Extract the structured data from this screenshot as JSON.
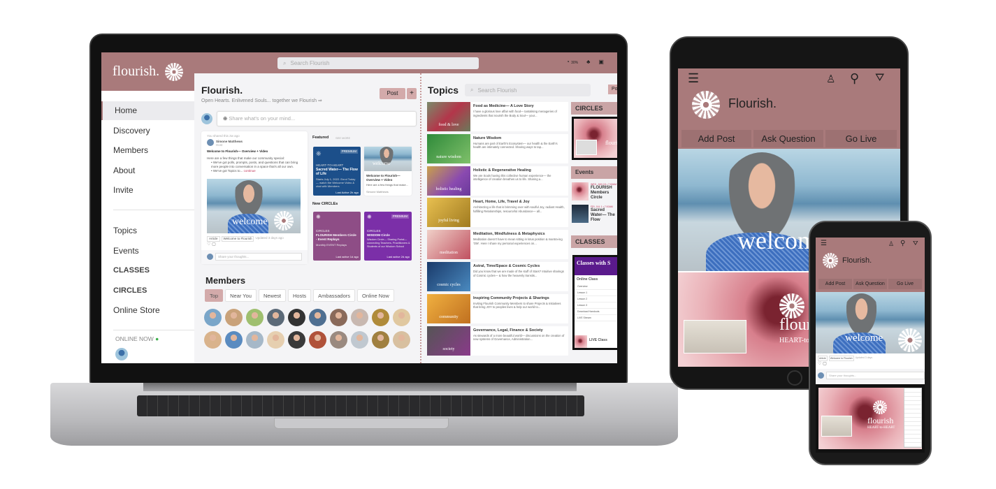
{
  "colors": {
    "brand": "#a97a7b",
    "sidebar_active": "#ebebee",
    "circle_card_1": "#8e4d86",
    "circle_card_2": "#7b2fa8",
    "featured_card": "#1c4f8a",
    "online_dot": "#3cae4b"
  },
  "laptop": {
    "logo": "flourish.",
    "search_placeholder": "Search Flourish",
    "top_icons": {
      "progress": "30%",
      "progress_icon": "pie-chart-icon",
      "members_icon": "people-icon",
      "chat_icon": "chat-icon"
    },
    "sidebar": {
      "items": [
        {
          "label": "Home",
          "active": true
        },
        {
          "label": "Discovery"
        },
        {
          "label": "Members"
        },
        {
          "label": "About"
        },
        {
          "label": "Invite"
        }
      ],
      "items2": [
        {
          "label": "Topics"
        },
        {
          "label": "Events"
        },
        {
          "label": "CLASSES"
        },
        {
          "label": "CIRCLES"
        },
        {
          "label": "Online Store"
        }
      ],
      "online_now": "ONLINE NOW"
    },
    "main": {
      "title": "Flourish.",
      "subtitle": "Open Hearts. Enlivened Souls... together we Flourish ⇒",
      "post_button": "Post",
      "add_button": "+",
      "share_placeholder": "Share what's on your mind...",
      "post": {
        "meta": "You shared this 2w ago",
        "author": "Simone Matthews",
        "role": "Host",
        "title": "Welcome to Flourish— Overview + Video",
        "intro": "Here are a few things that make our community special:",
        "bullet1": "We've got polls, prompts, posts, and questions that can bring more people into conversation in a space that's all our own.",
        "bullet2": "We've got Topics to...",
        "continue": "continue",
        "image_text": "welcome",
        "tags": [
          "Article",
          "Welcome to Flourish",
          "Updated 3 days ago"
        ],
        "comment_placeholder": "Share your thoughts..."
      },
      "featured": {
        "label": "Featured",
        "see_more": "SEE MORE",
        "card1": {
          "badge": "PREMIUM",
          "kicker": "HEART-TO-HEART",
          "title": "Sacred Water— The Flow of Life",
          "desc": "Starts July 1, 2022. Enrol Today— watch the Welcome Video & chat with Members",
          "activity": "Last Active 2h ago"
        },
        "card2": {
          "image_text": "welcome",
          "title": "Welcome to Flourish— Overview + Video",
          "desc": "Here are a few things that make...",
          "author": "Simone Matthews"
        }
      },
      "new_circles": {
        "label": "New CIRCLEs",
        "card1": {
          "kicker": "CIRCLES",
          "title": "FLOURISH Members Circle - Event Replays",
          "desc": "Monthly EVENT Replays",
          "activity": "Last active 1d ago"
        },
        "card2": {
          "badge": "PREMIUM",
          "kicker": "CIRCLES",
          "title": "WISDOM Circle",
          "desc": "Wisdom Circle— Sharing Portal— connecting Teachers, Practitioners & Students of our Wisdom School",
          "activity": "Last active 2d ago"
        }
      },
      "members": {
        "title": "Members",
        "tabs": [
          "Top",
          "Near You",
          "Newest",
          "Hosts",
          "Ambassadors",
          "Online Now"
        ],
        "active_tab": "Top",
        "avatar_count": 20
      }
    },
    "topics": {
      "title": "Topics",
      "search_placeholder": "Search Flourish",
      "items": [
        {
          "thumb": "food & love",
          "title": "Food as Medicine— A Love Story",
          "desc": "I have a glorious love affair with food— tantalising menageries of ingredients that nourish the Body & Soul— your..."
        },
        {
          "thumb": "nature wisdom",
          "title": "Nature Wisdom",
          "desc": "Humans are part of Earth's Ecosystem— our health & the Earth's health are intimately connected. Sharing ways to tap..."
        },
        {
          "thumb": "holistic healing",
          "title": "Holistic & Regenerative Healing",
          "desc": "We are Souls having this collective human experience— the intelligence of creation breathes us to life. Sharing a..."
        },
        {
          "thumb": "joyful living",
          "title": "Heart, Home, Life, Travel & Joy",
          "desc": "Architecting a life that is brimming over with soulful Joy, radiant Health, fulfilling Relationships, resourceful Abundance— all..."
        },
        {
          "thumb": "meditation",
          "title": "Meditation, Mindfulness & Metaphysics",
          "desc": "Meditation doesn't have to mean sitting in lotus position & mantra-ing 'OM'. Here I share my personal experiences on..."
        },
        {
          "thumb": "cosmic cycles",
          "title": "Astral, Time/Space & Cosmic Cycles",
          "desc": "Did you know that we are made of the stuff of Stars? Intuitive sharings of Cosmic cycles— & how the heavenly transits..."
        },
        {
          "thumb": "community",
          "title": "Inspiring Community Projects & Sharings",
          "desc": "Inviting Flourish Community Members to share Projects & Initiatives that bring JOY to peoples lives & help our world to..."
        },
        {
          "thumb": "society",
          "title": "Governance, Legal, Finance & Society",
          "desc": "As stewards of a more beautiful world— discussions on the creation of new systems of Governance, Administration..."
        }
      ],
      "post_button": "Post"
    },
    "right": {
      "circles": "CIRCLES",
      "circle_image_text": "flourish",
      "events": "Events",
      "event_items": [
        {
          "date": "WED, JUN 15 • 7:00AM",
          "title": "FLOURISH Members Circle"
        },
        {
          "date": "FRI, JUL 1 • 7:00AM",
          "title": "Sacred Water— The Flow"
        }
      ],
      "classes": "CLASSES",
      "classes_banner": "Classes with S",
      "classes_list_title": "Online Class",
      "lessons": [
        "Overview",
        "Lesson 1",
        "Lesson 2",
        "Lesson 3",
        "Download Handouts",
        "LIVE Stream"
      ],
      "live_class": "LIVE Class"
    }
  },
  "tablet": {
    "brand": "Flourish.",
    "actions": [
      "Add Post",
      "Ask Question",
      "Go Live"
    ],
    "hero_text": "welcom",
    "promo_title": "flouris",
    "promo_sub": "HEART-to-HEAR",
    "icons": [
      "menu-icon",
      "add-user-icon",
      "search-icon",
      "filter-icon"
    ]
  },
  "phone": {
    "brand": "Flourish.",
    "actions": [
      "Add Post",
      "Ask Question",
      "Go Live"
    ],
    "hero_text": "welcome",
    "tags": [
      "Article",
      "Welcome to Flourish",
      "Updated 3 days"
    ],
    "comment_placeholder": "Share your thoughts...",
    "promo_title": "flourish",
    "promo_sub": "HEART-to-HEART"
  }
}
